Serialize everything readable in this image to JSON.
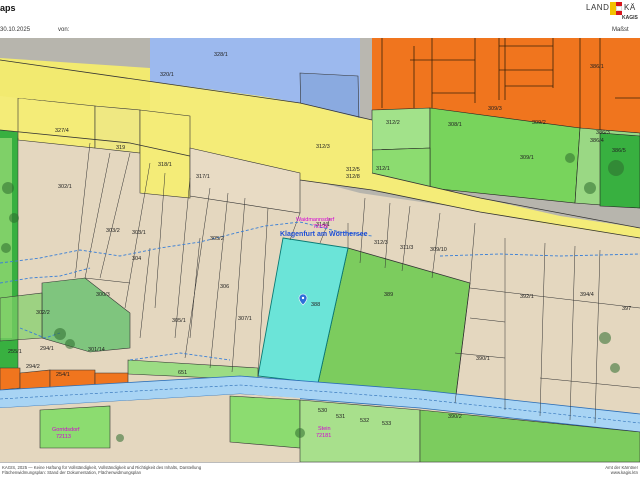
{
  "header": {
    "title": "aps",
    "date": "30.10.2025",
    "from_label": "von:",
    "scale_label": "Maßst",
    "logo_left": "LAND",
    "logo_right": "KÄ",
    "logo_sub": "KAGIS"
  },
  "map": {
    "place_name": "Klagenfurt am Wörthersee",
    "district_labels": [
      {
        "name": "Waidmannsdorf",
        "code": "72195"
      },
      {
        "name": "Gorridsdorf",
        "code": "72113"
      },
      {
        "name": "Stein",
        "code": "72181"
      }
    ],
    "marker_icon": "location-pin-icon",
    "selected_parcel": "388",
    "parcel_labels": [
      "328/1",
      "320/1",
      "319",
      "318/1",
      "327/4",
      "317/1",
      "312/3",
      "312/2",
      "312/1",
      "312/5",
      "312/8",
      "309/3",
      "309/2",
      "309/1",
      "308/1",
      "386/1",
      "386/4",
      "386/3",
      "386/5",
      "302/1",
      "303/2",
      "303/1",
      "304",
      "305/2",
      "306",
      "305/1",
      "307/1",
      "314/1",
      "312/3",
      "311/3",
      "309/10",
      "388",
      "389",
      "392/1",
      "394/4",
      "397",
      "390/1",
      "302/2",
      "300/3",
      "294/1",
      "301/14",
      "651",
      "530",
      "531",
      "532",
      "533",
      "390/2",
      "254/1",
      "294/2",
      "255/1"
    ],
    "colors": {
      "beige_parcel": "#e6d9c2",
      "light_green": "#8edc6c",
      "dark_green": "#38b040",
      "orange": "#f0751e",
      "blue": "#8fb2ee",
      "yellow_road": "#f5ee7a",
      "teal_highlight": "#52e8e0",
      "river_blue": "#a8d4f4",
      "dashed_river": "#3a7fd6"
    }
  },
  "footer": {
    "line1": "KAGIS, 2025 — Keine Haftung für Vollständigkeit, Vollständigkeit und Richtigkeit des Inhalts, Darstellung",
    "line2": "Flächenwidmungsplan: Stand der Dokumentation, Flächenwidmungsplan",
    "right1": "Amt der Kärntner",
    "right2": "www.kagis.ktn"
  }
}
